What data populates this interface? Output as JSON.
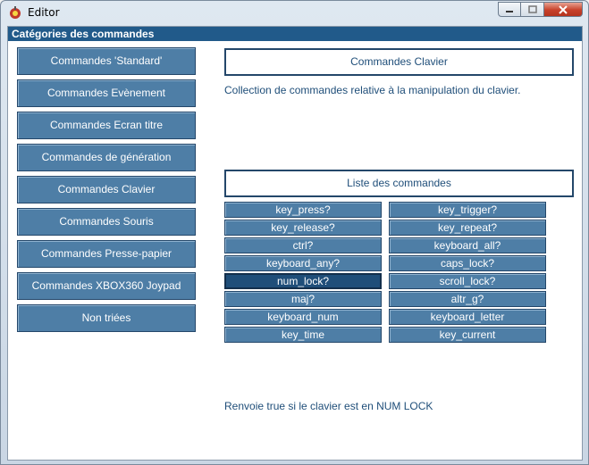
{
  "window": {
    "title": "Editor"
  },
  "panel": {
    "header": "Catégories des commandes"
  },
  "categories": [
    {
      "label": "Commandes 'Standard'"
    },
    {
      "label": "Commandes Evènement"
    },
    {
      "label": "Commandes Ecran titre"
    },
    {
      "label": "Commandes de génération"
    },
    {
      "label": "Commandes Clavier"
    },
    {
      "label": "Commandes Souris"
    },
    {
      "label": "Commandes Presse-papier"
    },
    {
      "label": "Commandes XBOX360 Joypad"
    },
    {
      "label": "Non triées"
    }
  ],
  "selected_category": {
    "title": "Commandes Clavier",
    "description": "Collection de commandes relative à la manipulation du clavier."
  },
  "command_list": {
    "title": "Liste des commandes",
    "left_column": [
      "key_press?",
      "key_release?",
      "ctrl?",
      "keyboard_any?",
      "num_lock?",
      "maj?",
      "keyboard_num",
      "key_time"
    ],
    "right_column": [
      "key_trigger?",
      "key_repeat?",
      "keyboard_all?",
      "caps_lock?",
      "scroll_lock?",
      "altr_g?",
      "keyboard_letter",
      "key_current"
    ],
    "selected": "num_lock?"
  },
  "status_text": "Renvoie true si le clavier est en NUM LOCK",
  "colors": {
    "accent": "#215a8a",
    "button": "#4e7ea6",
    "text": "#1f4e79"
  }
}
